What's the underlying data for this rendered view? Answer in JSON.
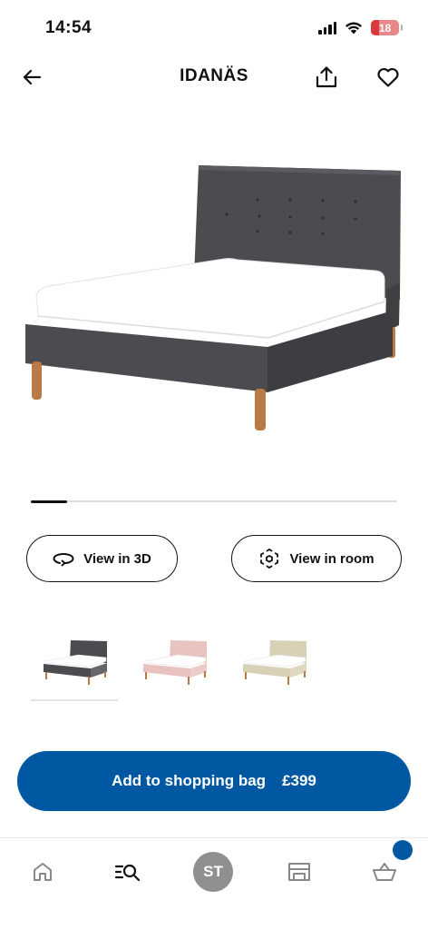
{
  "status_bar": {
    "time": "14:54",
    "battery_level": "18"
  },
  "header": {
    "title": "IDANÄS"
  },
  "product": {
    "image_alt": "IDANÄS upholstered bed in dark grey",
    "carousel_progress": 0.1
  },
  "actions": {
    "view_3d_label": "View in 3D",
    "view_room_label": "View in room"
  },
  "variants": [
    {
      "colour": "#4a4c50",
      "selected": true
    },
    {
      "colour": "#e9c3c0",
      "selected": false
    },
    {
      "colour": "#d8d1b6",
      "selected": false
    }
  ],
  "cta": {
    "label": "Add to shopping bag",
    "price": "£399"
  },
  "nav": {
    "avatar_initials": "ST"
  },
  "colors": {
    "brand_blue": "#0058a3",
    "bed_fabric": "#4a4c50",
    "legs": "#b97a45"
  }
}
